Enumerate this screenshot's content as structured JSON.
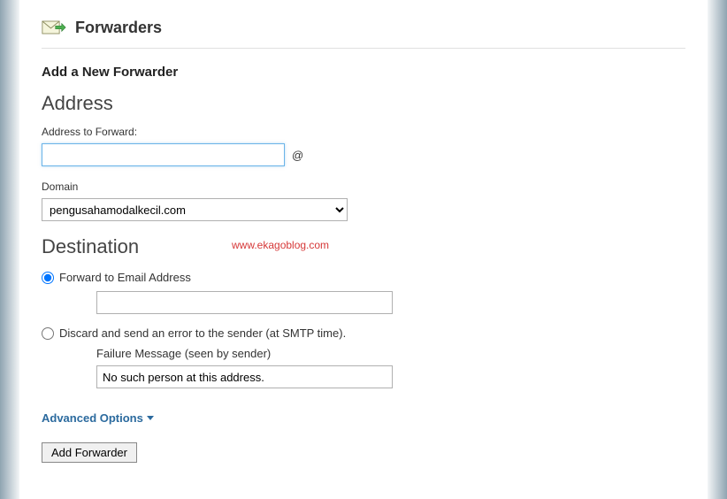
{
  "header": {
    "title": "Forwarders"
  },
  "form": {
    "title": "Add a New Forwarder",
    "address_section": "Address",
    "address_label": "Address to Forward:",
    "address_value": "",
    "at": "@",
    "domain_label": "Domain",
    "domain_value": "pengusahamodalkecil.com",
    "destination_section": "Destination",
    "option_forward": "Forward to Email Address",
    "forward_value": "",
    "option_discard": "Discard and send an error to the sender (at SMTP time).",
    "failure_label": "Failure Message (seen by sender)",
    "failure_value": "No such person at this address.",
    "advanced": "Advanced Options",
    "submit": "Add Forwarder"
  },
  "watermark": "www.ekagoblog.com"
}
